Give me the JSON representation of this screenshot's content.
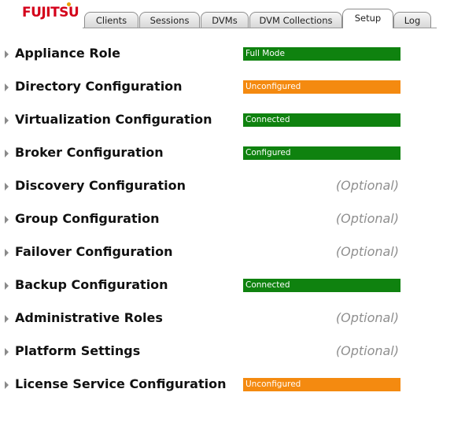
{
  "header": {
    "logo_text": "FUJITSU",
    "tabs": [
      {
        "label": "Clients"
      },
      {
        "label": "Sessions"
      },
      {
        "label": "DVMs"
      },
      {
        "label": "DVM Collections"
      },
      {
        "label": "Setup",
        "active": true
      },
      {
        "label": "Log"
      }
    ]
  },
  "sections": [
    {
      "label": "Appliance Role",
      "status": "Full Mode",
      "status_type": "green"
    },
    {
      "label": "Directory Configuration",
      "status": "Unconfigured",
      "status_type": "orange"
    },
    {
      "label": "Virtualization Configuration",
      "status": "Connected",
      "status_type": "green"
    },
    {
      "label": "Broker Configuration",
      "status": "Configured",
      "status_type": "green"
    },
    {
      "label": "Discovery Configuration",
      "status": "(Optional)",
      "status_type": "optional"
    },
    {
      "label": "Group Configuration",
      "status": "(Optional)",
      "status_type": "optional"
    },
    {
      "label": "Failover Configuration",
      "status": "(Optional)",
      "status_type": "optional"
    },
    {
      "label": "Backup Configuration",
      "status": "Connected",
      "status_type": "green"
    },
    {
      "label": "Administrative Roles",
      "status": "(Optional)",
      "status_type": "optional"
    },
    {
      "label": "Platform Settings",
      "status": "(Optional)",
      "status_type": "optional"
    },
    {
      "label": "License Service Configuration",
      "status": "Unconfigured",
      "status_type": "orange"
    }
  ],
  "colors": {
    "green": "#0f820f",
    "orange": "#f48a10",
    "logo": "#d4001a"
  }
}
